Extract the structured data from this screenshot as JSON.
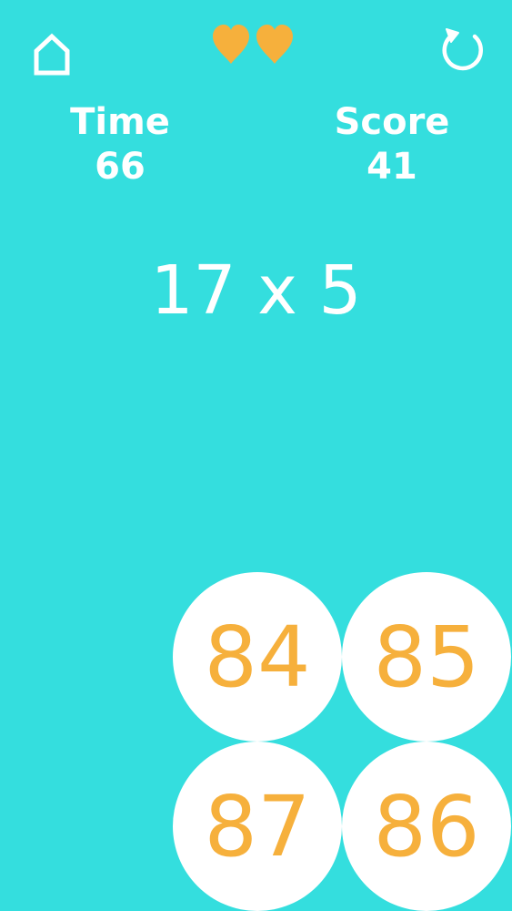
{
  "colors": {
    "background": "#34DEDE",
    "heart": "#F6B03C",
    "answer_text": "#F6B03C",
    "answer_bg": "#FFFFFF",
    "text": "#FFFFFF"
  },
  "toolbar": {
    "home_icon": "home-icon",
    "restart_icon": "restart-icon",
    "lives": 2
  },
  "stats": {
    "time_label": "Time",
    "time_value": "66",
    "score_label": "Score",
    "score_value": "41"
  },
  "question": "17 x 5",
  "answers": [
    "84",
    "85",
    "87",
    "86"
  ]
}
